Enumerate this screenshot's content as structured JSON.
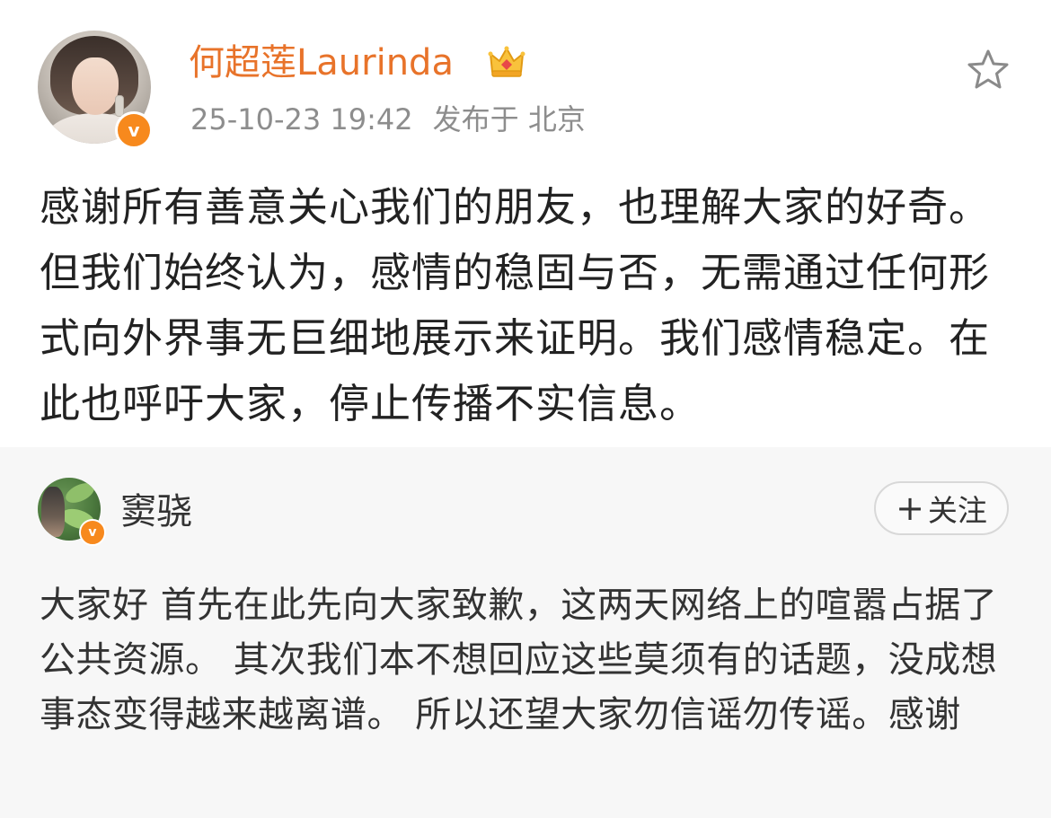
{
  "post": {
    "author": "何超莲Laurinda",
    "timestamp": "25-10-23 19:42",
    "location": "发布于 北京",
    "text": "感谢所有善意关心我们的朋友，也理解大家的好奇。但我们始终认为，感情的稳固与否，无需通过任何形式向外界事无巨细地展示来证明。我们感情稳定。在此也呼吁大家，停止传播不实信息。",
    "icons": {
      "crown": "crown-icon",
      "favorite": "star-icon",
      "verified": "verified-v-icon"
    }
  },
  "repost": {
    "author": "窦骁",
    "follow_label": "关注",
    "follow_icon": "plus-icon",
    "text": "大家好 首先在此先向大家致歉，这两天网络上的喧嚣占据了公共资源。 其次我们本不想回应这些莫须有的话题，没成想事态变得越来越离谱。 所以还望大家勿信谣勿传谣。感谢"
  },
  "colors": {
    "author_name": "#e8732a",
    "verified_badge": "#f7891d",
    "repost_background": "#f7f7f7",
    "meta_text": "#8d8d8d"
  },
  "badge": {
    "verified_glyph": "v"
  }
}
